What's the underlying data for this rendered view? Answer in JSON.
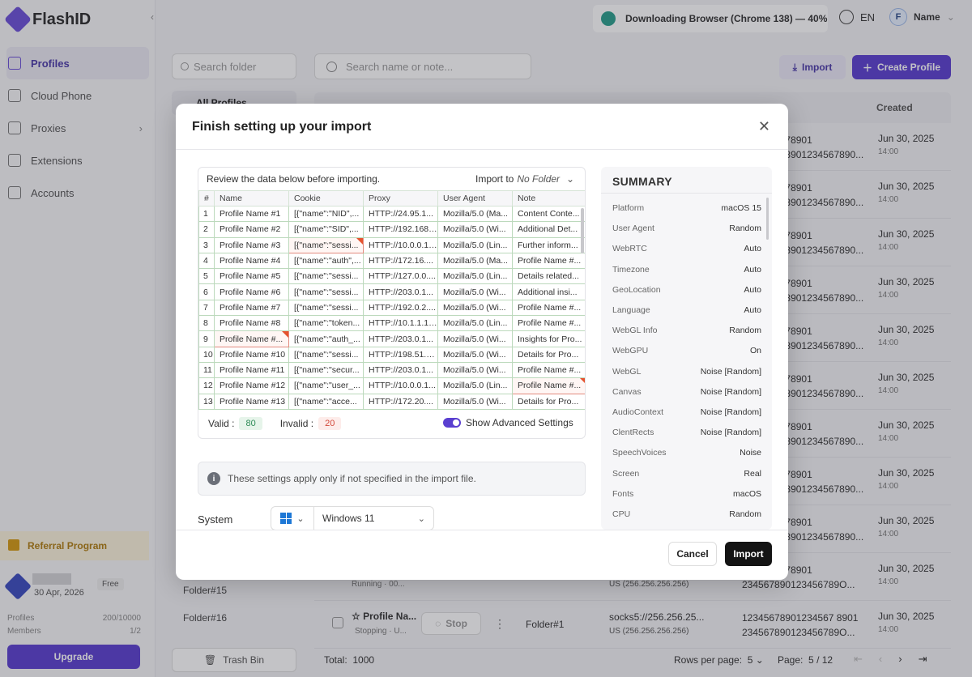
{
  "app": {
    "brand": "FlashID"
  },
  "sidebar": {
    "items": [
      {
        "label": "Profiles"
      },
      {
        "label": "Cloud Phone"
      },
      {
        "label": "Proxies"
      },
      {
        "label": "Extensions"
      },
      {
        "label": "Accounts"
      }
    ],
    "referral": "Referral Program",
    "plan": {
      "date": "30 Apr, 2026",
      "tier": "Free",
      "profiles_label": "Profiles",
      "profiles_value": "200/10000",
      "members_label": "Members",
      "members_value": "1/2",
      "upgrade": "Upgrade"
    }
  },
  "folders": {
    "search_placeholder": "Search folder",
    "all": "All Profiles",
    "items": [
      "Folder#15",
      "Folder#16"
    ],
    "trash": "Trash Bin"
  },
  "topbar": {
    "download": "Downloading Browser (Chrome 138) — 40%",
    "language": "EN",
    "user_initial": "F",
    "user_name": "Name"
  },
  "main": {
    "search_placeholder": "Search name or note...",
    "import_label": "Import",
    "create_label": "Create Profile",
    "created_header": "Created",
    "rows": [
      {
        "uuid1": "9012345678901",
        "uuid2": "012345678901234567890...",
        "date": "Jun 30, 2025",
        "time": "14:00"
      },
      {
        "uuid1": "9012345678901",
        "uuid2": "012345678901234567890...",
        "date": "Jun 30, 2025",
        "time": "14:00"
      },
      {
        "uuid1": "9012345678901",
        "uuid2": "012345678901234567890...",
        "date": "Jun 30, 2025",
        "time": "14:00"
      },
      {
        "uuid1": "9012345678901",
        "uuid2": "012345678901234567890...",
        "date": "Jun 30, 2025",
        "time": "14:00"
      },
      {
        "uuid1": "9012345678901",
        "uuid2": "012345678901234567890...",
        "date": "Jun 30, 2025",
        "time": "14:00"
      },
      {
        "uuid1": "9012345678901",
        "uuid2": "012345678901234567890...",
        "date": "Jun 30, 2025",
        "time": "14:00"
      },
      {
        "uuid1": "9012345678901",
        "uuid2": "012345678901234567890...",
        "date": "Jun 30, 2025",
        "time": "14:00"
      },
      {
        "uuid1": "9012345678901",
        "uuid2": "012345678901234567890...",
        "date": "Jun 30, 2025",
        "time": "14:00"
      },
      {
        "uuid1": "9012345678901",
        "uuid2": "012345678901234567890...",
        "date": "Jun 30, 2025",
        "time": "14:00"
      },
      {
        "uuid1": "9012345678901",
        "uuid2": "234567890123456789O...",
        "date": "Jun 30, 2025",
        "time": "14:00"
      },
      {
        "uuid1": "12345678901234567 8901",
        "uuid2": "234567890123456789O...",
        "date": "Jun 30, 2025",
        "time": "14:00"
      }
    ],
    "row10": {
      "status": "Running · 00...",
      "ip": "US (256.256.256.256)"
    },
    "row11": {
      "name": "Profile Na...",
      "status": "Stopping · U...",
      "stop": "Stop",
      "folder": "Folder#1",
      "proxy": "socks5://256.256.25...",
      "ip": "US (256.256.256.256)"
    },
    "footer": {
      "total": "Total:",
      "total_value": "1000",
      "rows_per_page": "Rows per page:",
      "rpp_value": "5",
      "page": "Page:",
      "page_value": "5",
      "page_total": "/ 12"
    }
  },
  "modal": {
    "title": "Finish setting up your import",
    "review": "Review the data below before importing.",
    "import_to_label": "Import to",
    "import_to_value": "No Folder",
    "columns": [
      "#",
      "Name",
      "Cookie",
      "Proxy",
      "User Agent",
      "Note"
    ],
    "rows": [
      [
        "1",
        "Profile Name #1",
        "[{\"name\":\"NID\",...",
        "HTTP://24.95.1...",
        "Mozilla/5.0 (Ma...",
        "Content Conte..."
      ],
      [
        "2",
        "Profile Name #2",
        "[{\"name\":\"SID\",...",
        "HTTP://192.168....",
        "Mozilla/5.0 (Wi...",
        "Additional Det..."
      ],
      [
        "3",
        "Profile Name #3",
        "[{\"name\":\"sessi...",
        "HTTP://10.0.0.1:...",
        "Mozilla/5.0 (Lin...",
        "Further inform..."
      ],
      [
        "4",
        "Profile Name #4",
        "[{\"name\":\"auth\",...",
        "HTTP://172.16....",
        "Mozilla/5.0 (Ma...",
        "Profile Name #..."
      ],
      [
        "5",
        "Profile Name #5",
        "[{\"name\":\"sessi...",
        "HTTP://127.0.0....",
        "Mozilla/5.0 (Lin...",
        "Details related..."
      ],
      [
        "6",
        "Profile Name #6",
        "[{\"name\":\"sessi...",
        "HTTP://203.0.1...",
        "Mozilla/5.0 (Wi...",
        "Additional insi..."
      ],
      [
        "7",
        "Profile Name #7",
        "[{\"name\":\"sessi...",
        "HTTP://192.0.2....",
        "Mozilla/5.0 (Wi...",
        "Profile Name #..."
      ],
      [
        "8",
        "Profile Name #8",
        "[{\"name\":\"token...",
        "HTTP://10.1.1.1:...",
        "Mozilla/5.0 (Lin...",
        "Profile Name #..."
      ],
      [
        "9",
        "Profile Name #...",
        "[{\"name\":\"auth_...",
        "HTTP://203.0.1...",
        "Mozilla/5.0 (Wi...",
        "Insights for Pro..."
      ],
      [
        "10",
        "Profile Name #10",
        "[{\"name\":\"sessi...",
        "HTTP://198.51.1...",
        "Mozilla/5.0 (Wi...",
        "Details for Pro..."
      ],
      [
        "11",
        "Profile Name #11",
        "[{\"name\":\"secur...",
        "HTTP://203.0.1...",
        "Mozilla/5.0 (Wi...",
        "Profile Name #..."
      ],
      [
        "12",
        "Profile Name #12",
        "[{\"name\":\"user_...",
        "HTTP://10.0.0.1...",
        "Mozilla/5.0 (Lin...",
        "Profile Name #..."
      ],
      [
        "13",
        "Profile Name #13",
        "[{\"name\":\"acce...",
        "HTTP://172.20....",
        "Mozilla/5.0 (Wi...",
        "Details for Pro..."
      ]
    ],
    "valid_label": "Valid :",
    "valid_value": "80",
    "invalid_label": "Invalid :",
    "invalid_value": "20",
    "advanced": "Show Advanced Settings",
    "info": "These settings apply only if not specified in the import file.",
    "system_label": "System",
    "system_version": "Windows 11",
    "summary_title": "SUMMARY",
    "summary": [
      {
        "k": "Platform",
        "v": "macOS 15"
      },
      {
        "k": "User Agent",
        "v": "Random"
      },
      {
        "k": "WebRTC",
        "v": "Auto"
      },
      {
        "k": "Timezone",
        "v": "Auto"
      },
      {
        "k": "GeoLocation",
        "v": "Auto"
      },
      {
        "k": "Language",
        "v": "Auto"
      },
      {
        "k": "WebGL Info",
        "v": "Random"
      },
      {
        "k": "WebGPU",
        "v": "On"
      },
      {
        "k": "WebGL",
        "v": "Noise [Random]"
      },
      {
        "k": "Canvas",
        "v": "Noise [Random]"
      },
      {
        "k": "AudioContext",
        "v": "Noise [Random]"
      },
      {
        "k": "ClentRects",
        "v": "Noise [Random]"
      },
      {
        "k": "SpeechVoices",
        "v": "Noise"
      },
      {
        "k": "Screen",
        "v": "Real"
      },
      {
        "k": "Fonts",
        "v": "macOS"
      },
      {
        "k": "CPU",
        "v": "Random"
      }
    ],
    "cancel": "Cancel",
    "import": "Import"
  }
}
